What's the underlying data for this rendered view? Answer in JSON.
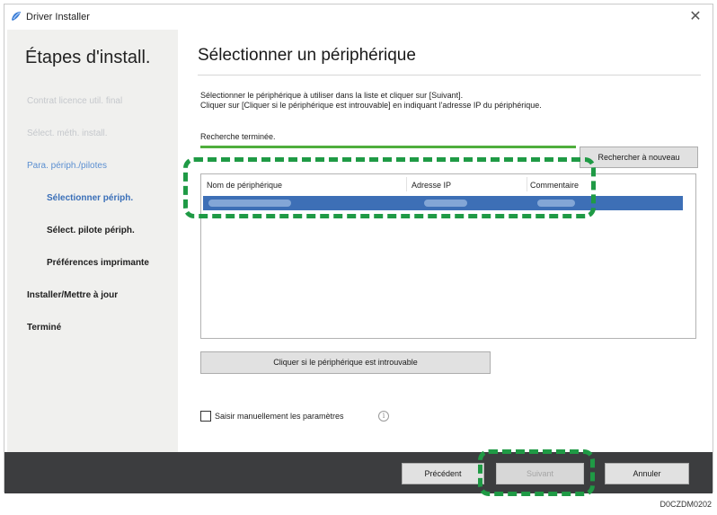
{
  "window": {
    "title": "Driver Installer",
    "close_glyph": "✕",
    "app_icon": "driver-installer-icon"
  },
  "sidebar": {
    "title": "Étapes d'install.",
    "steps": [
      {
        "label": "Contrat licence util. final",
        "state": "done"
      },
      {
        "label": "Sélect. méth. install.",
        "state": "done"
      },
      {
        "label": "Para. périph./pilotes",
        "state": "active-parent"
      },
      {
        "label": "Sélectionner périph.",
        "state": "active"
      },
      {
        "label": "Sélect. pilote périph.",
        "state": "pending"
      },
      {
        "label": "Préférences imprimante",
        "state": "pending"
      },
      {
        "label": "Installer/Mettre à jour",
        "state": "pending"
      },
      {
        "label": "Terminé",
        "state": "pending"
      }
    ]
  },
  "main": {
    "title": "Sélectionner un périphérique",
    "instruction_1": "Sélectionner le périphérique à utiliser dans la liste et cliquer sur [Suivant].",
    "instruction_2": "Cliquer sur [Cliquer si le périphérique est introuvable] en indiquant l'adresse IP du périphérique.",
    "status": "Recherche terminée.",
    "progress_fraction": 1.0,
    "refresh_button": "Rechercher à nouveau",
    "device_list": {
      "columns": [
        "Nom de périphérique",
        "Adresse IP",
        "Commentaire"
      ],
      "selected_row": 0
    },
    "not_found_button": "Cliquer si le périphérique est introuvable",
    "manual_checkbox": {
      "label": "Saisir manuellement les paramètres",
      "checked": false
    },
    "info_glyph": "i"
  },
  "footer": {
    "prev_button": "Précédent",
    "next_button": "Suivant",
    "cancel_button": "Annuler"
  },
  "caption": "D0CZDM0202",
  "colors": {
    "highlight": "#1f9a45",
    "selection": "#3d6fb6",
    "active_step": "#3a6fb8",
    "footer": "#3c3d3f",
    "progress": "#4fae3c"
  }
}
